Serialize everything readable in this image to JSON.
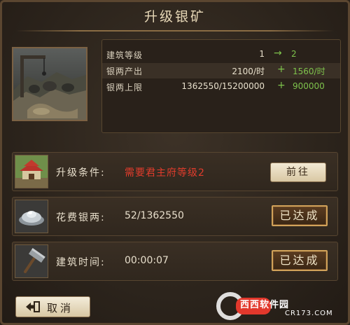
{
  "title": "升级银矿",
  "stats": [
    {
      "label": "建筑等级",
      "current": "1",
      "op": "→",
      "next": "2"
    },
    {
      "label": "银两产出",
      "current": "2100/时",
      "op": "+",
      "next": "1560/时"
    },
    {
      "label": "银两上限",
      "current": "1362550/15200000",
      "op": "+",
      "next": "900000"
    }
  ],
  "requirements": [
    {
      "label": "升级条件:",
      "value": "需要君主府等级2",
      "action": "前往",
      "icon": "palace-icon"
    },
    {
      "label": "花费银两:",
      "value": "52/1362550",
      "status": "已达成",
      "icon": "silver-ingot-icon"
    },
    {
      "label": "建筑时间:",
      "value": "00:00:07",
      "status": "已达成",
      "icon": "hammer-icon"
    }
  ],
  "cancel_label": "取消",
  "watermark": {
    "brand": "西西软件园",
    "url": "CR173.COM"
  },
  "colors": {
    "accent_green": "#7ec24c",
    "warning_red": "#e23c2c",
    "gold_border": "#d1a25a"
  }
}
